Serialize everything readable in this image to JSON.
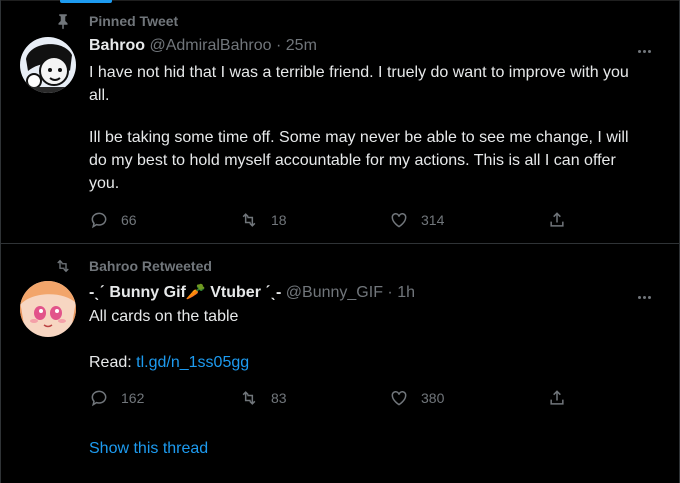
{
  "tweets": [
    {
      "social_context": "Pinned Tweet",
      "display_name": "Bahroo",
      "handle": "@AdmiralBahroo",
      "separator": "·",
      "time": "25m",
      "text_line1": "I have not hid that I was a terrible friend. I truely do want to improve with you all.",
      "text_line2": "Ill be taking some time off. Some may never be able to see me change, I will do my best to hold myself accountable for my actions. This is all I can offer you.",
      "replies": "66",
      "retweets": "18",
      "likes": "314",
      "icons": [
        "pin-icon",
        "reply-icon",
        "retweet-icon",
        "like-icon",
        "share-icon",
        "more-icon"
      ]
    },
    {
      "social_context": "Bahroo Retweeted",
      "display_name_prefix": "-ˎˊ Bunny Gif",
      "display_name_emoji": "🥕",
      "display_name_suffix": " Vtuber ˊˎ-",
      "handle": "@Bunny_GIF",
      "separator": "·",
      "time": "1h",
      "text_line1": "All cards on the table",
      "read_label": "Read:",
      "link": "tl.gd/n_1ss05gg",
      "replies": "162",
      "retweets": "83",
      "likes": "380",
      "show_thread": "Show this thread",
      "icons": [
        "retweet-icon",
        "reply-icon",
        "retweet-icon",
        "like-icon",
        "share-icon",
        "more-icon"
      ]
    }
  ],
  "colors": {
    "background": "#000000",
    "text": "#e7e9ea",
    "muted": "#71767b",
    "accent": "#1d9bf0",
    "divider": "#2f3336"
  }
}
